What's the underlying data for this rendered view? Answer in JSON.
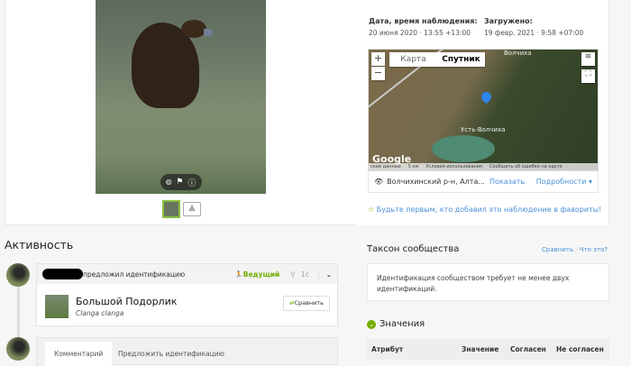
{
  "observation": {
    "date_label": "Дата, время наблюдения:",
    "date_value": "20 июня 2020 · 13:55 +13:00",
    "uploaded_label": "Загружено:",
    "uploaded_value": "19 февр. 2021 · 9:58 +07:00"
  },
  "map": {
    "type_map": "Карта",
    "type_satellite": "Спутник",
    "zoom_in": "+",
    "zoom_out": "−",
    "place_top": "Волчиха",
    "place_center": "Усть-Волчиха",
    "google": "Google",
    "footer": [
      "ские данные",
      "5 км",
      "Условия использования",
      "Сообщить об ошибке на карте"
    ]
  },
  "location": {
    "text": "Волчихинский р-н, Алта...",
    "show": "Показать",
    "details": "Подробности ▾"
  },
  "favorite": "Будьте первым, кто добавил это наблюдение в фавориты!",
  "activity": {
    "title": "Активность",
    "action": "предложил идентификацию",
    "leading": "Ведущий",
    "age": "1с",
    "taxon_name": "Большой Подорлик",
    "taxon_sci": "Clanga clanga",
    "compare": "Сравнить",
    "tabs": [
      "Комментарий",
      "Предложить идентификацию"
    ]
  },
  "community": {
    "title": "Таксон сообщества",
    "compare": "Сравнить",
    "what": "Что это?",
    "sep": "·",
    "message": "Идентификация сообществом требует не менее двух идентификаций."
  },
  "annotations": {
    "title": "Значения",
    "columns": [
      "Атрибут",
      "Значение",
      "Согласен",
      "Не согласен"
    ]
  },
  "colors": {
    "accent": "#74ac00",
    "link": "#4a90d9"
  }
}
